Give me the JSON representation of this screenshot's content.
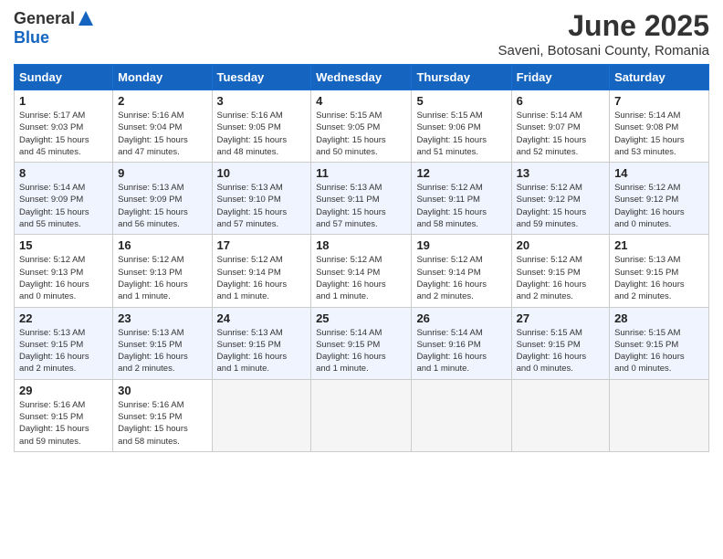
{
  "header": {
    "logo_general": "General",
    "logo_blue": "Blue",
    "month": "June 2025",
    "location": "Saveni, Botosani County, Romania"
  },
  "weekdays": [
    "Sunday",
    "Monday",
    "Tuesday",
    "Wednesday",
    "Thursday",
    "Friday",
    "Saturday"
  ],
  "weeks": [
    [
      {
        "day": 1,
        "lines": [
          "Sunrise: 5:17 AM",
          "Sunset: 9:03 PM",
          "Daylight: 15 hours",
          "and 45 minutes."
        ]
      },
      {
        "day": 2,
        "lines": [
          "Sunrise: 5:16 AM",
          "Sunset: 9:04 PM",
          "Daylight: 15 hours",
          "and 47 minutes."
        ]
      },
      {
        "day": 3,
        "lines": [
          "Sunrise: 5:16 AM",
          "Sunset: 9:05 PM",
          "Daylight: 15 hours",
          "and 48 minutes."
        ]
      },
      {
        "day": 4,
        "lines": [
          "Sunrise: 5:15 AM",
          "Sunset: 9:05 PM",
          "Daylight: 15 hours",
          "and 50 minutes."
        ]
      },
      {
        "day": 5,
        "lines": [
          "Sunrise: 5:15 AM",
          "Sunset: 9:06 PM",
          "Daylight: 15 hours",
          "and 51 minutes."
        ]
      },
      {
        "day": 6,
        "lines": [
          "Sunrise: 5:14 AM",
          "Sunset: 9:07 PM",
          "Daylight: 15 hours",
          "and 52 minutes."
        ]
      },
      {
        "day": 7,
        "lines": [
          "Sunrise: 5:14 AM",
          "Sunset: 9:08 PM",
          "Daylight: 15 hours",
          "and 53 minutes."
        ]
      }
    ],
    [
      {
        "day": 8,
        "lines": [
          "Sunrise: 5:14 AM",
          "Sunset: 9:09 PM",
          "Daylight: 15 hours",
          "and 55 minutes."
        ]
      },
      {
        "day": 9,
        "lines": [
          "Sunrise: 5:13 AM",
          "Sunset: 9:09 PM",
          "Daylight: 15 hours",
          "and 56 minutes."
        ]
      },
      {
        "day": 10,
        "lines": [
          "Sunrise: 5:13 AM",
          "Sunset: 9:10 PM",
          "Daylight: 15 hours",
          "and 57 minutes."
        ]
      },
      {
        "day": 11,
        "lines": [
          "Sunrise: 5:13 AM",
          "Sunset: 9:11 PM",
          "Daylight: 15 hours",
          "and 57 minutes."
        ]
      },
      {
        "day": 12,
        "lines": [
          "Sunrise: 5:12 AM",
          "Sunset: 9:11 PM",
          "Daylight: 15 hours",
          "and 58 minutes."
        ]
      },
      {
        "day": 13,
        "lines": [
          "Sunrise: 5:12 AM",
          "Sunset: 9:12 PM",
          "Daylight: 15 hours",
          "and 59 minutes."
        ]
      },
      {
        "day": 14,
        "lines": [
          "Sunrise: 5:12 AM",
          "Sunset: 9:12 PM",
          "Daylight: 16 hours",
          "and 0 minutes."
        ]
      }
    ],
    [
      {
        "day": 15,
        "lines": [
          "Sunrise: 5:12 AM",
          "Sunset: 9:13 PM",
          "Daylight: 16 hours",
          "and 0 minutes."
        ]
      },
      {
        "day": 16,
        "lines": [
          "Sunrise: 5:12 AM",
          "Sunset: 9:13 PM",
          "Daylight: 16 hours",
          "and 1 minute."
        ]
      },
      {
        "day": 17,
        "lines": [
          "Sunrise: 5:12 AM",
          "Sunset: 9:14 PM",
          "Daylight: 16 hours",
          "and 1 minute."
        ]
      },
      {
        "day": 18,
        "lines": [
          "Sunrise: 5:12 AM",
          "Sunset: 9:14 PM",
          "Daylight: 16 hours",
          "and 1 minute."
        ]
      },
      {
        "day": 19,
        "lines": [
          "Sunrise: 5:12 AM",
          "Sunset: 9:14 PM",
          "Daylight: 16 hours",
          "and 2 minutes."
        ]
      },
      {
        "day": 20,
        "lines": [
          "Sunrise: 5:12 AM",
          "Sunset: 9:15 PM",
          "Daylight: 16 hours",
          "and 2 minutes."
        ]
      },
      {
        "day": 21,
        "lines": [
          "Sunrise: 5:13 AM",
          "Sunset: 9:15 PM",
          "Daylight: 16 hours",
          "and 2 minutes."
        ]
      }
    ],
    [
      {
        "day": 22,
        "lines": [
          "Sunrise: 5:13 AM",
          "Sunset: 9:15 PM",
          "Daylight: 16 hours",
          "and 2 minutes."
        ]
      },
      {
        "day": 23,
        "lines": [
          "Sunrise: 5:13 AM",
          "Sunset: 9:15 PM",
          "Daylight: 16 hours",
          "and 2 minutes."
        ]
      },
      {
        "day": 24,
        "lines": [
          "Sunrise: 5:13 AM",
          "Sunset: 9:15 PM",
          "Daylight: 16 hours",
          "and 1 minute."
        ]
      },
      {
        "day": 25,
        "lines": [
          "Sunrise: 5:14 AM",
          "Sunset: 9:15 PM",
          "Daylight: 16 hours",
          "and 1 minute."
        ]
      },
      {
        "day": 26,
        "lines": [
          "Sunrise: 5:14 AM",
          "Sunset: 9:16 PM",
          "Daylight: 16 hours",
          "and 1 minute."
        ]
      },
      {
        "day": 27,
        "lines": [
          "Sunrise: 5:15 AM",
          "Sunset: 9:15 PM",
          "Daylight: 16 hours",
          "and 0 minutes."
        ]
      },
      {
        "day": 28,
        "lines": [
          "Sunrise: 5:15 AM",
          "Sunset: 9:15 PM",
          "Daylight: 16 hours",
          "and 0 minutes."
        ]
      }
    ],
    [
      {
        "day": 29,
        "lines": [
          "Sunrise: 5:16 AM",
          "Sunset: 9:15 PM",
          "Daylight: 15 hours",
          "and 59 minutes."
        ]
      },
      {
        "day": 30,
        "lines": [
          "Sunrise: 5:16 AM",
          "Sunset: 9:15 PM",
          "Daylight: 15 hours",
          "and 58 minutes."
        ]
      },
      null,
      null,
      null,
      null,
      null
    ]
  ]
}
